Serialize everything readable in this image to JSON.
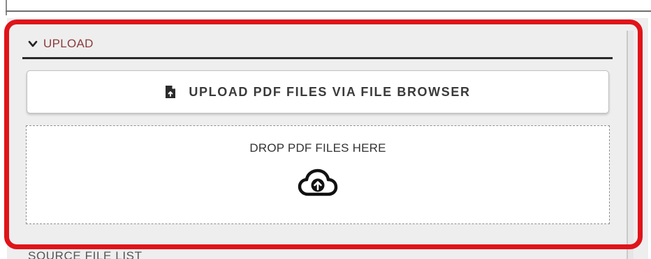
{
  "section": {
    "title": "UPLOAD",
    "expanded": true
  },
  "upload_button": {
    "label": "UPLOAD PDF FILES VIA FILE BROWSER",
    "icon": "file-upload-icon"
  },
  "dropzone": {
    "label": "DROP PDF FILES HERE",
    "icon": "cloud-upload-icon"
  },
  "next_section": {
    "title": "SOURCE FILE LIST"
  },
  "colors": {
    "highlight": "#e0141a",
    "section_title": "#8c3b3b",
    "panel_background": "#eeeeee"
  }
}
